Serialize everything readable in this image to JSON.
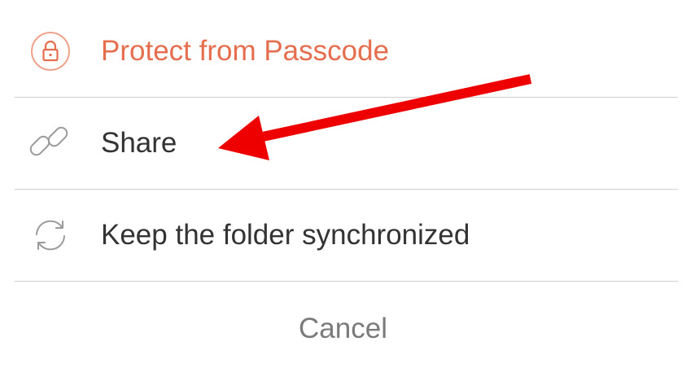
{
  "action_sheet": {
    "items": [
      {
        "label": "Protect from Passcode",
        "icon": "lock-icon",
        "accent_color": "#e46e4e"
      },
      {
        "label": "Share",
        "icon": "link-icon"
      },
      {
        "label": "Keep the folder synchronized",
        "icon": "sync-icon"
      }
    ],
    "cancel_label": "Cancel"
  },
  "annotation": {
    "type": "arrow",
    "color": "#ee0000",
    "points_to": "Share"
  }
}
